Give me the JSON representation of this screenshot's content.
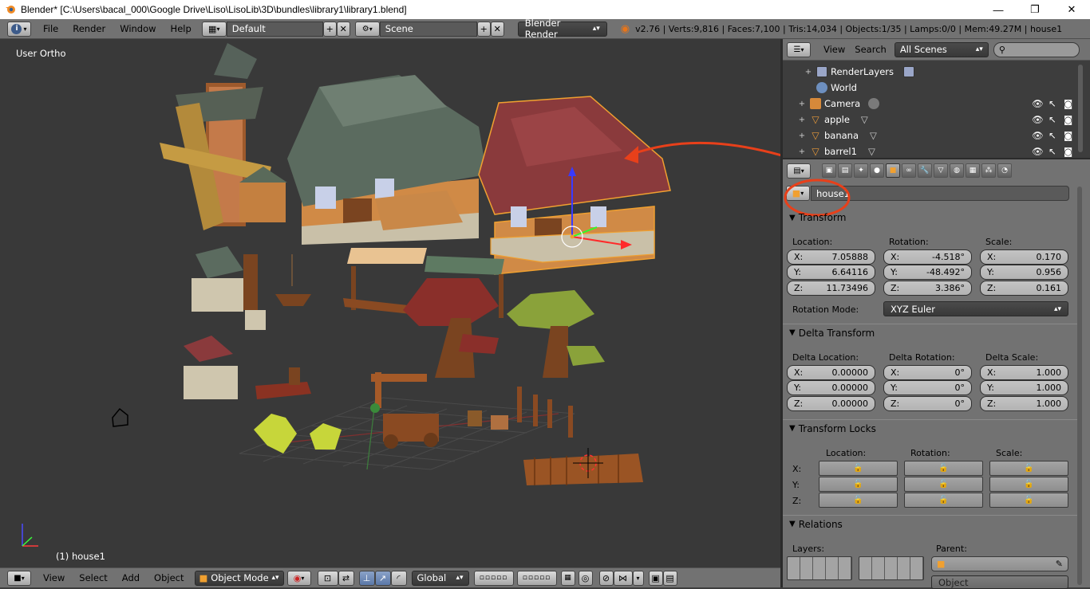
{
  "window": {
    "title": "Blender* [C:\\Users\\bacal_000\\Google Drive\\Liso\\LisoLib\\3D\\bundles\\library1\\library1.blend]",
    "minimize": "—",
    "maximize": "❐",
    "close": "✕"
  },
  "infobar": {
    "menus": [
      "File",
      "Render",
      "Window",
      "Help"
    ],
    "layout": "Default",
    "scene": "Scene",
    "engine": "Blender Render",
    "stats": "v2.76 | Verts:9,816 | Faces:7,100 | Tris:14,034 | Objects:1/35 | Lamps:0/0 | Mem:49.27M | house1"
  },
  "viewport": {
    "view_label": "User Ortho",
    "object_label": "(1) house1"
  },
  "view3d_header": {
    "menus": [
      "View",
      "Select",
      "Add",
      "Object"
    ],
    "mode": "Object Mode",
    "orientation": "Global"
  },
  "outliner": {
    "menus": [
      "View",
      "Search"
    ],
    "filter": "All Scenes",
    "rows": [
      {
        "name": "RenderLayers",
        "icon": "render-layers-icon",
        "color": "#9aa6c8",
        "expand": "+",
        "indent": 1
      },
      {
        "name": "World",
        "icon": "world-icon",
        "color": "#6d8fbf",
        "expand": "",
        "indent": 1
      },
      {
        "name": "Camera",
        "icon": "camera-icon",
        "color": "#d6893a",
        "expand": "+",
        "indent": 0
      },
      {
        "name": "apple",
        "icon": "mesh-icon",
        "color": "#e89a3a",
        "expand": "+",
        "indent": 0
      },
      {
        "name": "banana",
        "icon": "mesh-icon",
        "color": "#e89a3a",
        "expand": "+",
        "indent": 0
      },
      {
        "name": "barrel1",
        "icon": "mesh-icon",
        "color": "#e89a3a",
        "expand": "+",
        "indent": 0
      }
    ]
  },
  "properties": {
    "object_name": "house1",
    "transform": {
      "title": "Transform",
      "location_label": "Location:",
      "rotation_label": "Rotation:",
      "scale_label": "Scale:",
      "location": [
        {
          "k": "X:",
          "v": "7.05888"
        },
        {
          "k": "Y:",
          "v": "6.64116"
        },
        {
          "k": "Z:",
          "v": "11.73496"
        }
      ],
      "rotation": [
        {
          "k": "X:",
          "v": "-4.518°"
        },
        {
          "k": "Y:",
          "v": "-48.492°"
        },
        {
          "k": "Z:",
          "v": "3.386°"
        }
      ],
      "scale": [
        {
          "k": "X:",
          "v": "0.170"
        },
        {
          "k": "Y:",
          "v": "0.956"
        },
        {
          "k": "Z:",
          "v": "0.161"
        }
      ],
      "rotation_mode_label": "Rotation Mode:",
      "rotation_mode": "XYZ Euler"
    },
    "delta": {
      "title": "Delta Transform",
      "location_label": "Delta Location:",
      "rotation_label": "Delta Rotation:",
      "scale_label": "Delta Scale:",
      "location": [
        {
          "k": "X:",
          "v": "0.00000"
        },
        {
          "k": "Y:",
          "v": "0.00000"
        },
        {
          "k": "Z:",
          "v": "0.00000"
        }
      ],
      "rotation": [
        {
          "k": "X:",
          "v": "0°"
        },
        {
          "k": "Y:",
          "v": "0°"
        },
        {
          "k": "Z:",
          "v": "0°"
        }
      ],
      "scale": [
        {
          "k": "X:",
          "v": "1.000"
        },
        {
          "k": "Y:",
          "v": "1.000"
        },
        {
          "k": "Z:",
          "v": "1.000"
        }
      ]
    },
    "locks": {
      "title": "Transform Locks",
      "location_label": "Location:",
      "rotation_label": "Rotation:",
      "scale_label": "Scale:",
      "axes": [
        "X:",
        "Y:",
        "Z:"
      ]
    },
    "relations": {
      "title": "Relations",
      "layers_label": "Layers:",
      "parent_label": "Parent:",
      "parent_type": "Object"
    }
  }
}
